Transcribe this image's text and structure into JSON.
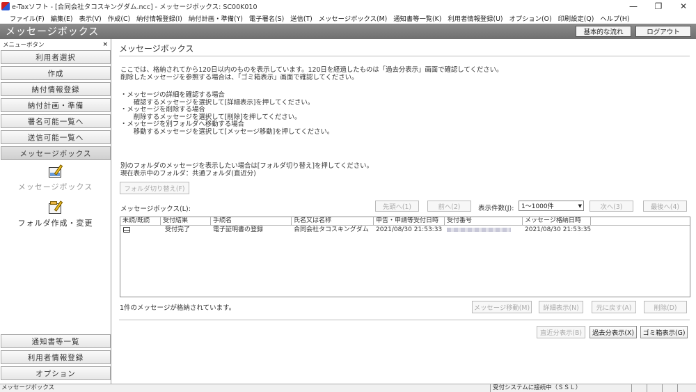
{
  "window": {
    "title": "e-Taxソフト - [合同会社タコスキングダム.ncc] - メッセージボックス: SC00K010",
    "controls": {
      "minimize": "—",
      "restore": "❐",
      "close": "✕"
    }
  },
  "menu": [
    "ファイル(F)",
    "編集(E)",
    "表示(V)",
    "作成(C)",
    "納付情報登録(I)",
    "納付計画・準備(Y)",
    "電子署名(S)",
    "送信(T)",
    "メッセージボックス(M)",
    "通知書等一覧(K)",
    "利用者情報登録(U)",
    "オプション(O)",
    "印刷設定(Q)",
    "ヘルプ(H)"
  ],
  "header": {
    "title": "メッセージボックス",
    "flow_button": "基本的な流れ",
    "logout_button": "ログアウト"
  },
  "sidebar": {
    "heading": "メニューボタン",
    "close": "×",
    "items": [
      "利用者選択",
      "作成",
      "納付情報登録",
      "納付計画・準備",
      "署名可能一覧へ",
      "送信可能一覧へ",
      "メッセージボックス"
    ],
    "folder_message_box": "メッセージボックス",
    "folder_create": "フォルダ作成・変更",
    "bottom_items": [
      "通知書等一覧",
      "利用者情報登録",
      "オプション"
    ]
  },
  "main": {
    "title": "メッセージボックス",
    "description_1": "ここでは、格納されてから120日以内のものを表示しています。120日を経過したものは「過去分表示」画面で確認してください。\n削除したメッセージを参照する場合は、「ゴミ箱表示」画面で確認してください。",
    "description_2": "・メッセージの詳細を確認する場合\n　　確認するメッセージを選択して[詳細表示]を押してください。\n・メッセージを削除する場合\n　　削除するメッセージを選択して[削除]を押してください。\n・メッセージを別フォルダへ移動する場合\n　　移動するメッセージを選択して[メッセージ移動]を押してください。",
    "folder_text": "別のフォルダのメッセージを表示したい場合は[フォルダ切り替え]を押してください。\n現在表示中のフォルダ：共通フォルダ(直近分)",
    "folder_switch_button": "フォルダ切り替え(F)",
    "list_label": "メッセージボックス(L):",
    "nav": {
      "first": "先頭へ(1)",
      "prev": "前へ(2)",
      "next": "次へ(3)",
      "last": "最後へ(4)"
    },
    "count_label": "表示件数(J):",
    "count_value": "1～1000件",
    "columns": [
      "未読/既読",
      "受付結果",
      "手続名",
      "氏名又は名称",
      "申告・申請等受付日時",
      "受付番号",
      "メッセージ格納日時"
    ],
    "rows": [
      {
        "status": "受付完了",
        "procedure": "電子証明書の登録",
        "name": "合同会社タコスキングダム",
        "received": "2021/08/30 21:53:33",
        "stored": "2021/08/30 21:53:35"
      }
    ],
    "message_count": "1件のメッセージが格納されています。",
    "actions": {
      "move": "メッセージ移動(M)",
      "detail": "詳細表示(N)",
      "restore": "元に戻す(A)",
      "delete": "削除(D)"
    },
    "footer_buttons": {
      "recent": "直近分表示(B)",
      "past": "過去分表示(X)",
      "trash": "ゴミ箱表示(G)"
    }
  },
  "statusbar": {
    "left": "メッセージボックス",
    "connection": "受付システムに接続中（ＳＳＬ）"
  }
}
